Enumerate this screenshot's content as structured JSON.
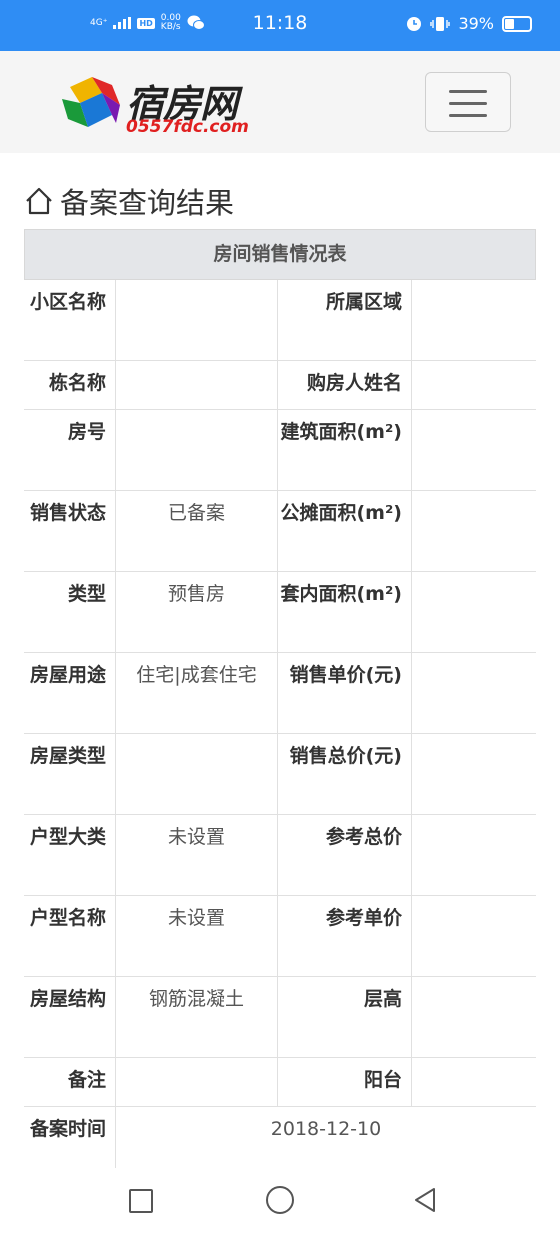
{
  "status_bar": {
    "network": "4G⁺",
    "hd": "HD",
    "speed": "0.00",
    "speed_unit": "KB/s",
    "time": "11:18",
    "battery": "39%",
    "battery_level": 0.39
  },
  "header": {
    "logo_name": "宿房网",
    "logo_domain": "0557fdc.com"
  },
  "page": {
    "title": "备案查询结果",
    "table_title": "房间销售情况表"
  },
  "table": {
    "rows": [
      {
        "l1": "小区名称",
        "v1": "",
        "l2": "所属区域",
        "v2": ""
      },
      {
        "l1": "栋名称",
        "v1": "",
        "l2": "购房人姓名",
        "v2": ""
      },
      {
        "l1": "房号",
        "v1": "",
        "l2": "建筑面积(m²)",
        "v2": ""
      },
      {
        "l1": "销售状态",
        "v1": "已备案",
        "l2": "公摊面积(m²)",
        "v2": ""
      },
      {
        "l1": "类型",
        "v1": "预售房",
        "l2": "套内面积(m²)",
        "v2": ""
      },
      {
        "l1": "房屋用途",
        "v1": "住宅|成套住宅",
        "l2": "销售单价(元)",
        "v2": ""
      },
      {
        "l1": "房屋类型",
        "v1": "",
        "l2": "销售总价(元)",
        "v2": ""
      },
      {
        "l1": "户型大类",
        "v1": "未设置",
        "l2": "参考总价",
        "v2": ""
      },
      {
        "l1": "户型名称",
        "v1": "未设置",
        "l2": "参考单价",
        "v2": ""
      },
      {
        "l1": "房屋结构",
        "v1": "钢筋混凝土",
        "l2": "层高",
        "v2": ""
      },
      {
        "l1": "备注",
        "v1": "",
        "l2": "阳台",
        "v2": ""
      }
    ],
    "last_row": {
      "label": "备案时间",
      "value": "2018-12-10"
    }
  }
}
